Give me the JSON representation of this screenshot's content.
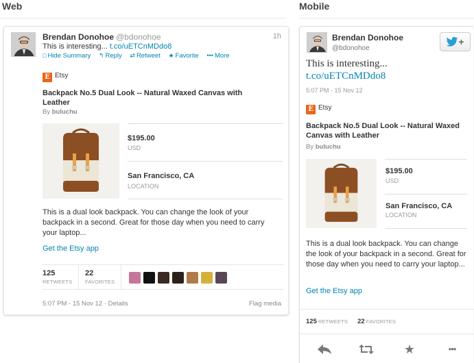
{
  "labels": {
    "web": "Web",
    "mobile": "Mobile"
  },
  "tweet": {
    "author_name": "Brendan Donohoe",
    "handle": "@bdonohoe",
    "relative_time": "1h",
    "text_prefix": "This is interesting...",
    "link": "t.co/uETCnMDdo8",
    "timestamp": "5:07 PM - 15 Nov 12",
    "details": "Details",
    "flag_media": "Flag media"
  },
  "web_actions": [
    {
      "icon": "summary-icon",
      "glyph": "□",
      "label": "Hide Summary"
    },
    {
      "icon": "reply-icon",
      "glyph": "↰",
      "label": "Reply"
    },
    {
      "icon": "retweet-icon",
      "glyph": "⇄",
      "label": "Retweet"
    },
    {
      "icon": "star-icon",
      "glyph": "★",
      "label": "Favorite"
    },
    {
      "icon": "more-icon",
      "glyph": "•••",
      "label": "More"
    }
  ],
  "card": {
    "source": "Etsy",
    "source_initial": "E",
    "title": "Backpack No.5 Dual Look -- Natural Waxed Canvas with Leather",
    "by_prefix": "By",
    "by_user": "buluchu",
    "price": "$195.00",
    "price_label": "USD",
    "location": "San Francisco, CA",
    "location_label": "LOCATION",
    "description": "This is a dual look backpack. You can change the look of your backpack in a second. Great for those day when you need to carry your laptop...",
    "get_app": "Get the Etsy app"
  },
  "stats": {
    "retweets": "125",
    "retweets_label": "RETWEETS",
    "favorites": "22",
    "favorites_label": "FAVORITES"
  },
  "colors": {
    "link": "#0084b4",
    "etsy": "#e8651a",
    "twitter_bird": "#2a9fd8",
    "faces": [
      "#c8759a",
      "#111111",
      "#3b2a24",
      "#2b2118",
      "#b07a4a",
      "#d4b23a",
      "#5a4656"
    ]
  },
  "mobile_actions": [
    {
      "icon": "reply-icon",
      "glyph": "↰"
    },
    {
      "icon": "retweet-icon",
      "glyph": "⇄"
    },
    {
      "icon": "star-icon",
      "glyph": "★"
    },
    {
      "icon": "more-icon",
      "glyph": "•••"
    }
  ]
}
